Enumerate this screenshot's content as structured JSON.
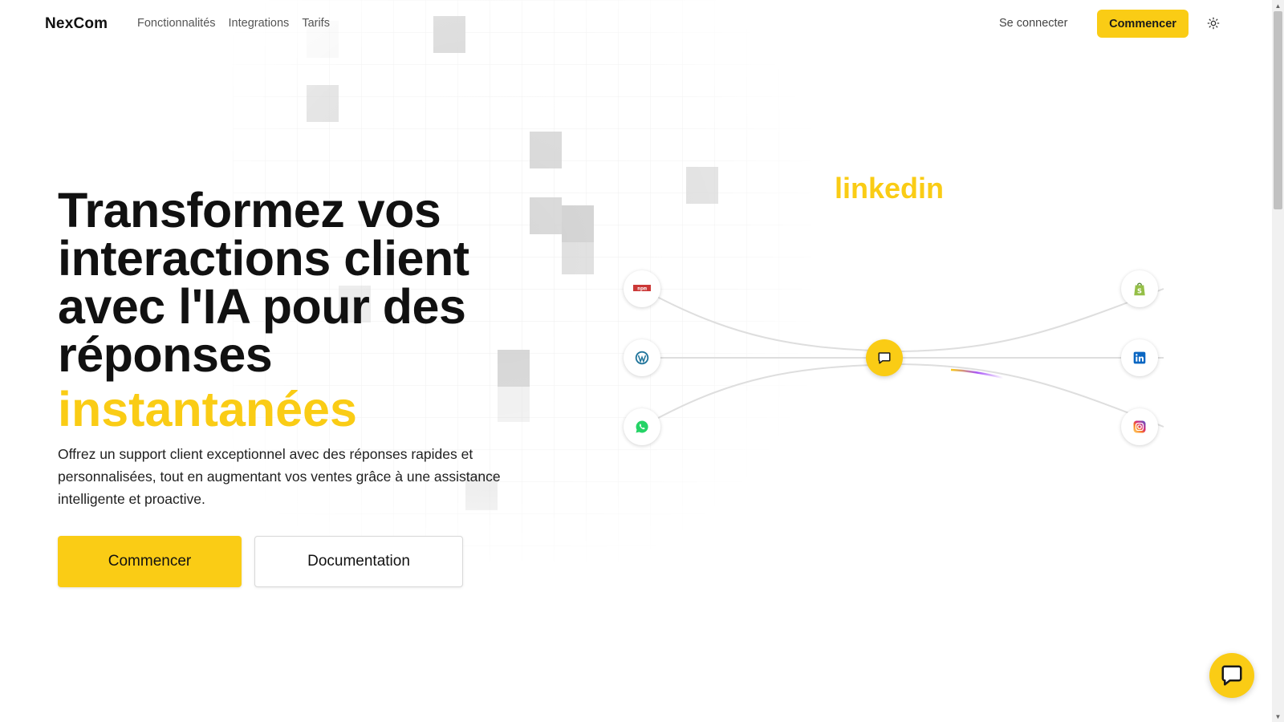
{
  "header": {
    "logo": "NexCom",
    "nav": [
      "Fonctionnalités",
      "Integrations",
      "Tarifs"
    ],
    "login": "Se connecter",
    "start_button": "Commencer",
    "theme_icon": "sun-icon"
  },
  "hero": {
    "title": "Transformez vos interactions client avec l'IA pour des réponses",
    "highlight": "instantanées",
    "subtitle": "Offrez un support client exceptionnel avec des réponses rapides et personnalisées, tout en augmentant vos ventes grâce à une assistance intelligente et proactive.",
    "primary_cta": "Commencer",
    "secondary_cta": "Documentation"
  },
  "integrations": {
    "active_label": "linkedin",
    "hub_icon": "chat-bubble-icon",
    "left_nodes": [
      {
        "name": "npm",
        "icon": "npm-icon",
        "color": "#cb3837"
      },
      {
        "name": "wordpress",
        "icon": "wordpress-icon",
        "color": "#21759b"
      },
      {
        "name": "whatsapp",
        "icon": "whatsapp-icon",
        "color": "#25d366"
      }
    ],
    "right_nodes": [
      {
        "name": "shopify",
        "icon": "shopify-icon",
        "color": "#95bf47"
      },
      {
        "name": "linkedin",
        "icon": "linkedin-icon",
        "color": "#0a66c2"
      },
      {
        "name": "instagram",
        "icon": "instagram-icon",
        "color": "#e1306c"
      }
    ]
  },
  "chat_widget_icon": "chat-icon",
  "colors": {
    "accent": "#facc15",
    "text": "#111111",
    "muted": "#555555"
  }
}
